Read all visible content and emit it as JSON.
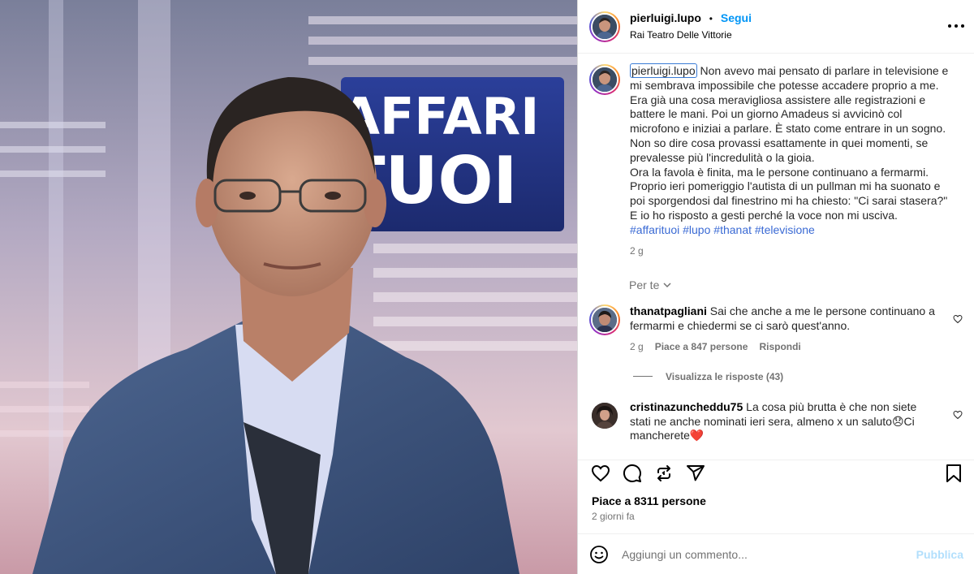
{
  "post": {
    "username": "pierluigi.lupo",
    "follow_label": "Segui",
    "location": "Rai Teatro Delle Vittorie",
    "sign_line1": "AFFARI",
    "sign_line2": "TUOI",
    "caption_text": "Non avevo mai pensato di parlare in televisione e mi sembrava impossibile che potesse accadere proprio a me. Era già una cosa meravigliosa assistere alle registrazioni e battere le mani. Poi un giorno Amadeus si avvicinò col microfono e iniziai a parlare. È stato come entrare in un sogno. Non so dire cosa provassi esattamente in quei momenti, se prevalesse più l'incredulità o la gioia.\nOra la favola è finita, ma le persone continuano a fermarmi. Proprio ieri pomeriggio l'autista di un pullman mi ha suonato e poi sporgendosi dal finestrino mi ha chiesto: \"Ci sarai stasera?\"\nE io ho risposto a gesti perché la voce non mi usciva.",
    "hashtags": [
      "#affarituoi",
      "#lupo",
      "#thanat",
      "#televisione"
    ],
    "caption_time": "2 g",
    "sort_label": "Per te",
    "likes_text": "Piace a 8311 persone",
    "posted_ago": "2 giorni fa",
    "comment_placeholder": "Aggiungi un commento...",
    "publish_label": "Pubblica"
  },
  "comments": [
    {
      "username": "thanatpagliani",
      "text": "Sai che anche a me le persone continuano a fermarmi e chiedermi se ci sarò quest'anno.",
      "time": "2 g",
      "likes": "Piace a 847 persone",
      "reply_label": "Rispondi",
      "view_replies": "Visualizza le risposte (43)"
    },
    {
      "username": "cristinazuncheddu75",
      "text": "La cosa più brutta è che non siete stati ne anche nominati ieri sera, almeno x un saluto😞Ci mancherete❤️"
    }
  ],
  "icons": {
    "like": "heart-icon",
    "comment": "comment-icon",
    "repost": "repost-icon",
    "share": "share-icon",
    "save": "bookmark-icon",
    "emoji": "emoji-icon",
    "more": "more-icon"
  },
  "colors": {
    "link_blue": "#0095f6",
    "hashtag_blue": "#3a6ad4",
    "muted": "#737373",
    "publish_disabled": "#b2dffc"
  }
}
